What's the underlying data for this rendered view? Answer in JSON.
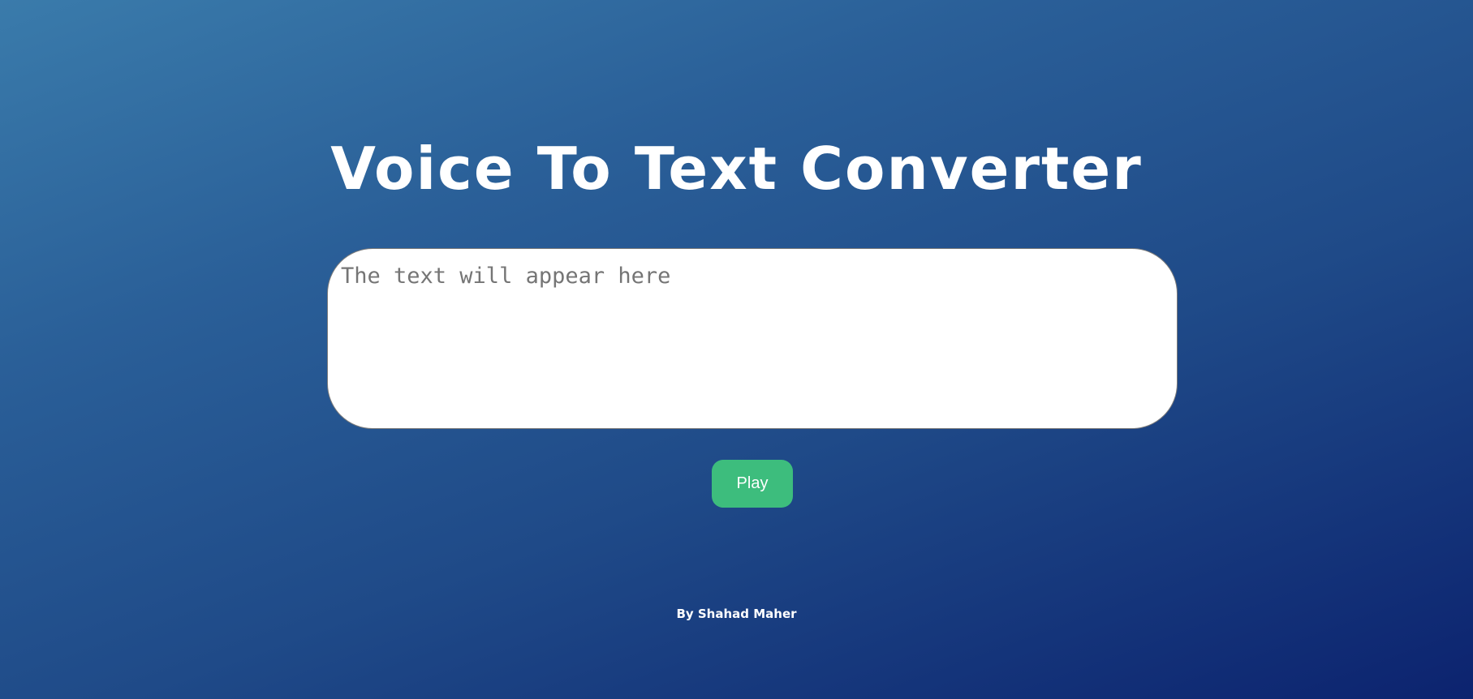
{
  "page": {
    "title": "Voice To Text Converter",
    "textarea_placeholder": "The text will appear here",
    "textarea_value": "",
    "play_button_label": "Play",
    "credit": "By Shahad Maher"
  },
  "colors": {
    "background_start": "#3a7bab",
    "background_end": "#0c236f",
    "button": "#3dbd7d",
    "text": "#ffffff"
  }
}
